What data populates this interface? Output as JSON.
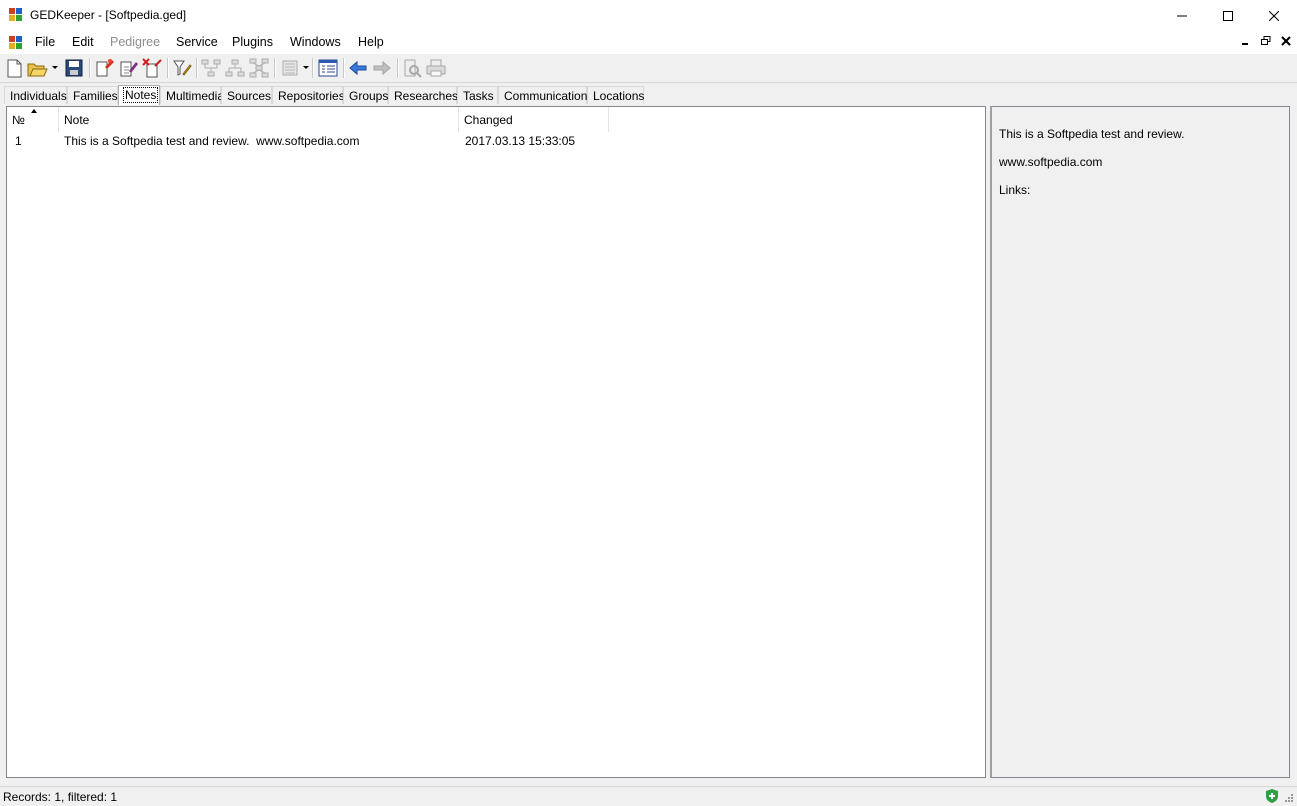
{
  "window": {
    "title": "GEDKeeper - [Softpedia.ged]",
    "icon": "gedkeeper-app-icon"
  },
  "menu": {
    "items": [
      {
        "label": "File",
        "disabled": false
      },
      {
        "label": "Edit",
        "disabled": false
      },
      {
        "label": "Pedigree",
        "disabled": true
      },
      {
        "label": "Service",
        "disabled": false
      },
      {
        "label": "Plugins",
        "disabled": false
      },
      {
        "label": "Windows",
        "disabled": false
      },
      {
        "label": "Help",
        "disabled": false
      }
    ]
  },
  "toolbar": {
    "icons": [
      "new-file-icon",
      "open-file-icon",
      "save-icon",
      "add-record-icon",
      "edit-record-icon",
      "delete-record-icon",
      "filter-icon",
      "tree-ancestors-icon",
      "tree-descendants-icon",
      "tree-both-icon",
      "pedigree-icon",
      "records-list-icon",
      "back-arrow-icon",
      "forward-arrow-icon",
      "preview-icon",
      "print-icon"
    ]
  },
  "tabs": [
    {
      "label": "Individuals"
    },
    {
      "label": "Families"
    },
    {
      "label": "Notes",
      "active": true
    },
    {
      "label": "Multimedia"
    },
    {
      "label": "Sources"
    },
    {
      "label": "Repositories"
    },
    {
      "label": "Groups"
    },
    {
      "label": "Researches"
    },
    {
      "label": "Tasks"
    },
    {
      "label": "Communications"
    },
    {
      "label": "Locations"
    }
  ],
  "list": {
    "columns": [
      "№",
      "Note",
      "Changed"
    ],
    "rows": [
      {
        "num": "1",
        "note": "This is a Softpedia test and review.  www.softpedia.com",
        "changed": "2017.03.13 15:33:05"
      }
    ]
  },
  "detail": {
    "line1": "This is a Softpedia test and review.",
    "line2": "www.softpedia.com",
    "links_label": "Links:"
  },
  "status": {
    "text": "Records: 1, filtered: 1"
  },
  "colors": {
    "accent_shield": "#2ea043",
    "border": "#828790"
  }
}
